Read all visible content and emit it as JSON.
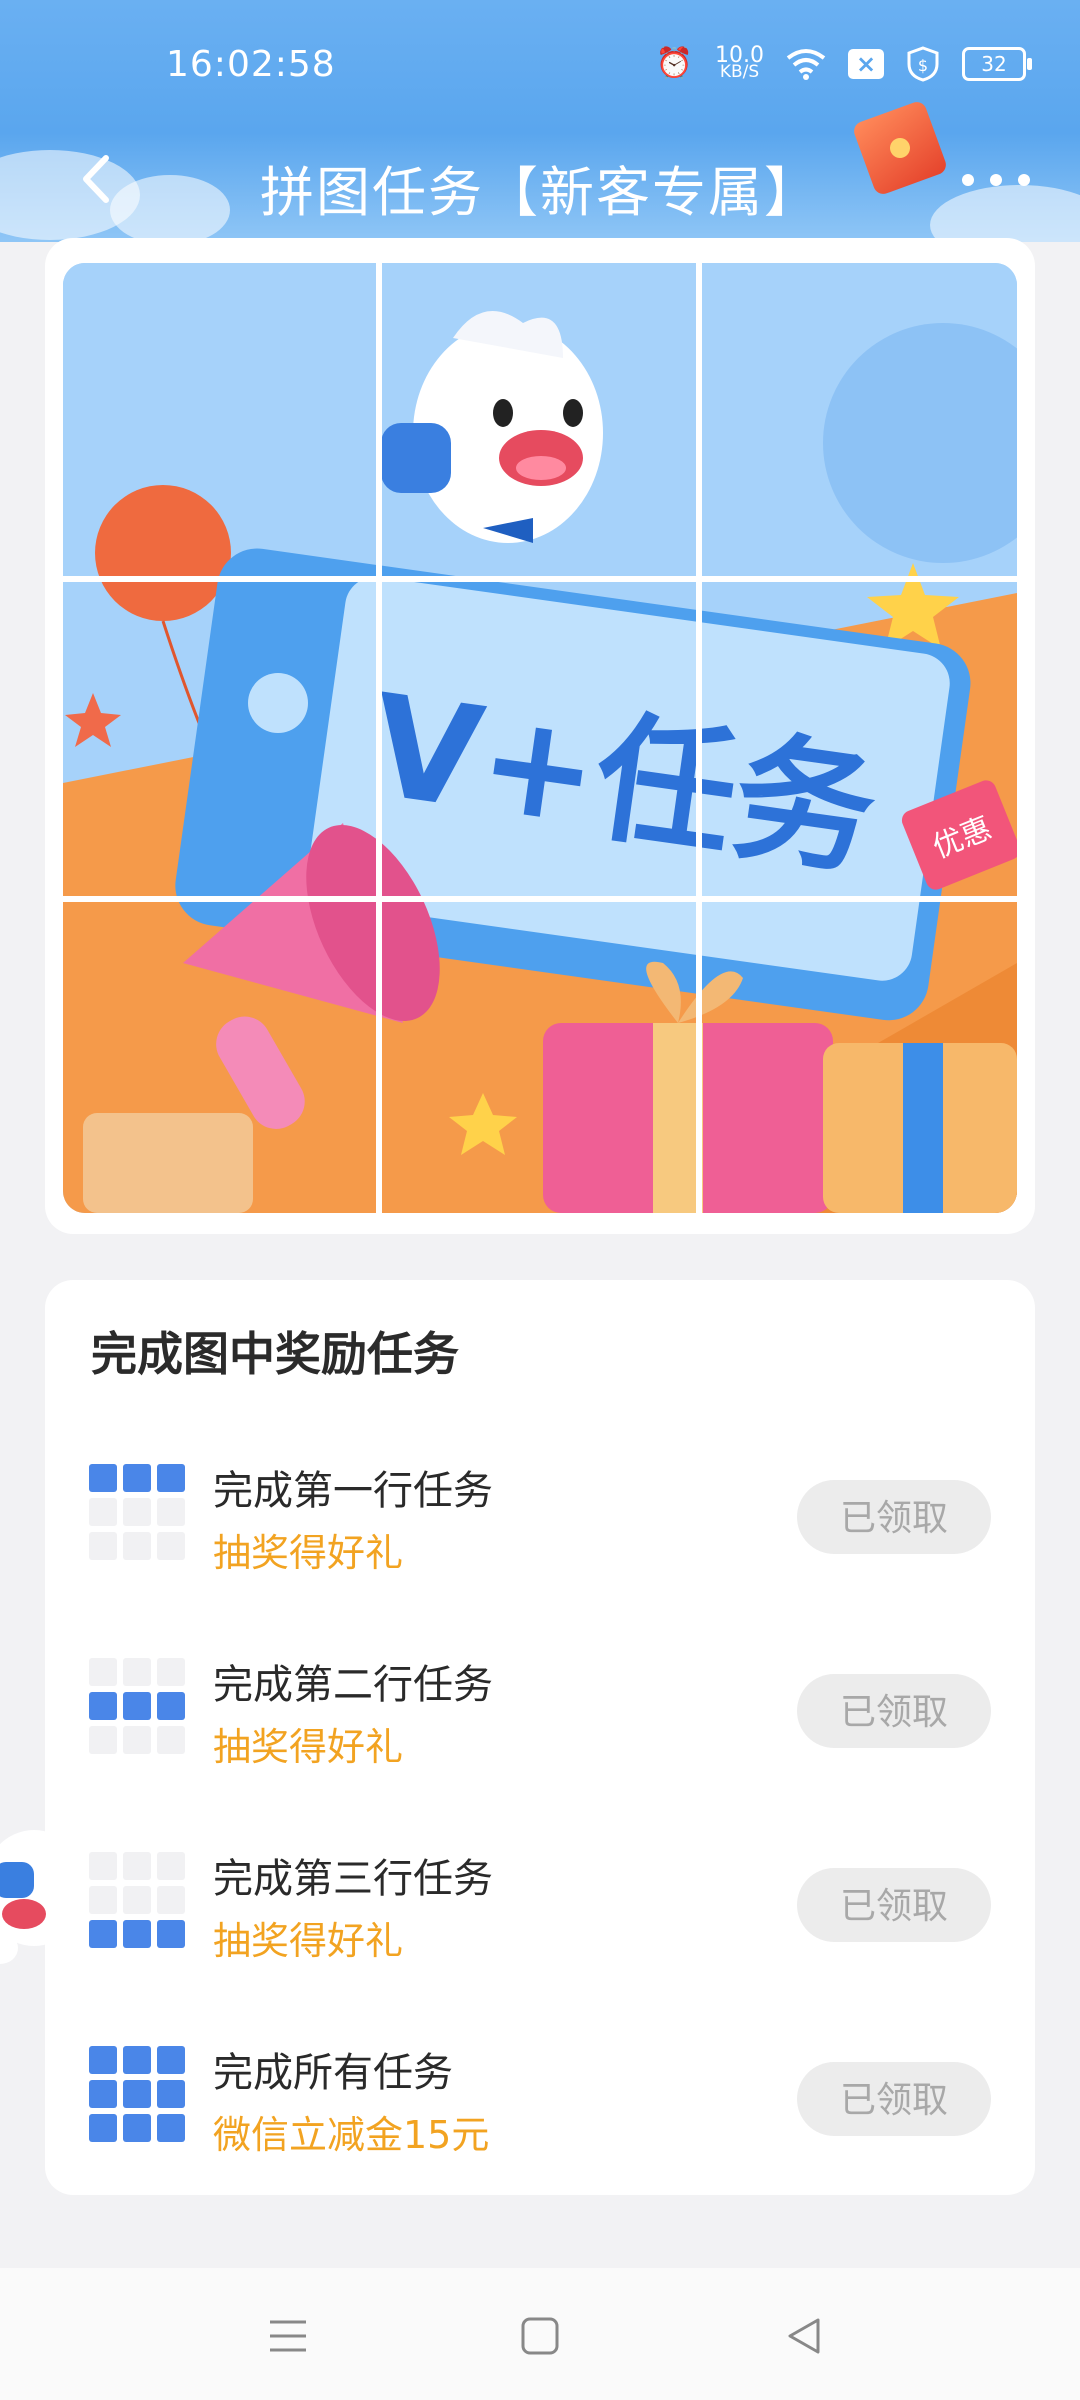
{
  "status_bar": {
    "time": "16:02:58",
    "net_speed_value": "10.0",
    "net_speed_unit": "KB/S",
    "battery": "32"
  },
  "nav": {
    "title": "拼图任务【新客专属】"
  },
  "puzzle": {
    "banner_text": "V+任务",
    "badge_text": "优惠"
  },
  "tasks": {
    "heading": "完成图中奖励任务",
    "items": [
      {
        "name": "完成第一行任务",
        "reward": "抽奖得好礼",
        "button": "已领取"
      },
      {
        "name": "完成第二行任务",
        "reward": "抽奖得好礼",
        "button": "已领取"
      },
      {
        "name": "完成第三行任务",
        "reward": "抽奖得好礼",
        "button": "已领取"
      },
      {
        "name": "完成所有任务",
        "reward": "微信立减金15元",
        "button": "已领取"
      }
    ]
  },
  "colors": {
    "header_blue": "#5aa6ee",
    "reward_orange": "#f2a321",
    "grid_blue": "#4a86e8",
    "claimed_gray": "#ececec"
  }
}
